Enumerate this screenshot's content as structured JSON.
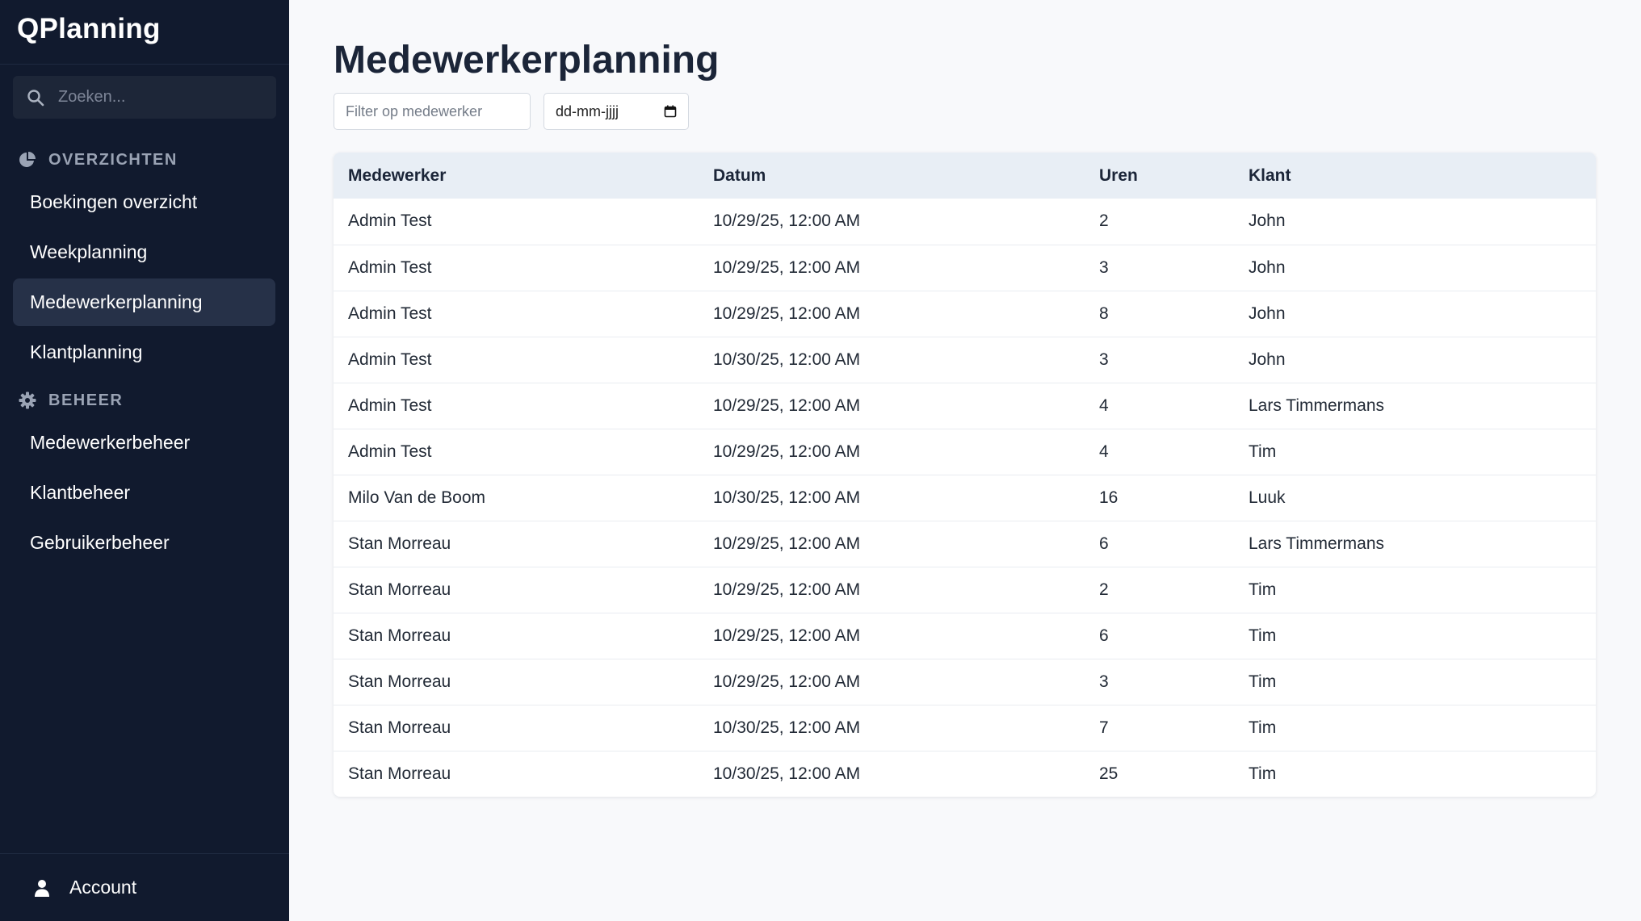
{
  "app": {
    "brand": "QPlanning"
  },
  "sidebar": {
    "search_placeholder": "Zoeken...",
    "sections": [
      {
        "title": "OVERZICHTEN",
        "icon": "pie-chart-icon",
        "items": [
          {
            "label": "Boekingen overzicht",
            "active": false
          },
          {
            "label": "Weekplanning",
            "active": false
          },
          {
            "label": "Medewerkerplanning",
            "active": true
          },
          {
            "label": "Klantplanning",
            "active": false
          }
        ]
      },
      {
        "title": "BEHEER",
        "icon": "gear-icon",
        "items": [
          {
            "label": "Medewerkerbeheer",
            "active": false
          },
          {
            "label": "Klantbeheer",
            "active": false
          },
          {
            "label": "Gebruikerbeheer",
            "active": false
          }
        ]
      }
    ],
    "footer": {
      "label": "Account",
      "icon": "user-icon"
    }
  },
  "main": {
    "title": "Medewerkerplanning",
    "filters": {
      "employee_placeholder": "Filter op medewerker",
      "date_placeholder": "dd-mm-jjjj"
    },
    "table": {
      "headers": [
        "Medewerker",
        "Datum",
        "Uren",
        "Klant"
      ],
      "rows": [
        [
          "Admin Test",
          "10/29/25, 12:00 AM",
          "2",
          "John"
        ],
        [
          "Admin Test",
          "10/29/25, 12:00 AM",
          "3",
          "John"
        ],
        [
          "Admin Test",
          "10/29/25, 12:00 AM",
          "8",
          "John"
        ],
        [
          "Admin Test",
          "10/30/25, 12:00 AM",
          "3",
          "John"
        ],
        [
          "Admin Test",
          "10/29/25, 12:00 AM",
          "4",
          "Lars Timmermans"
        ],
        [
          "Admin Test",
          "10/29/25, 12:00 AM",
          "4",
          "Tim"
        ],
        [
          "Milo Van de Boom",
          "10/30/25, 12:00 AM",
          "16",
          "Luuk"
        ],
        [
          "Stan Morreau",
          "10/29/25, 12:00 AM",
          "6",
          "Lars Timmermans"
        ],
        [
          "Stan Morreau",
          "10/29/25, 12:00 AM",
          "2",
          "Tim"
        ],
        [
          "Stan Morreau",
          "10/29/25, 12:00 AM",
          "6",
          "Tim"
        ],
        [
          "Stan Morreau",
          "10/29/25, 12:00 AM",
          "3",
          "Tim"
        ],
        [
          "Stan Morreau",
          "10/30/25, 12:00 AM",
          "7",
          "Tim"
        ],
        [
          "Stan Morreau",
          "10/30/25, 12:00 AM",
          "25",
          "Tim"
        ]
      ]
    }
  },
  "colors": {
    "sidebar_bg": "#111a2e",
    "active_item_bg": "#263148",
    "table_header_bg": "#e8eef5",
    "page_bg": "#f8f9fb"
  }
}
